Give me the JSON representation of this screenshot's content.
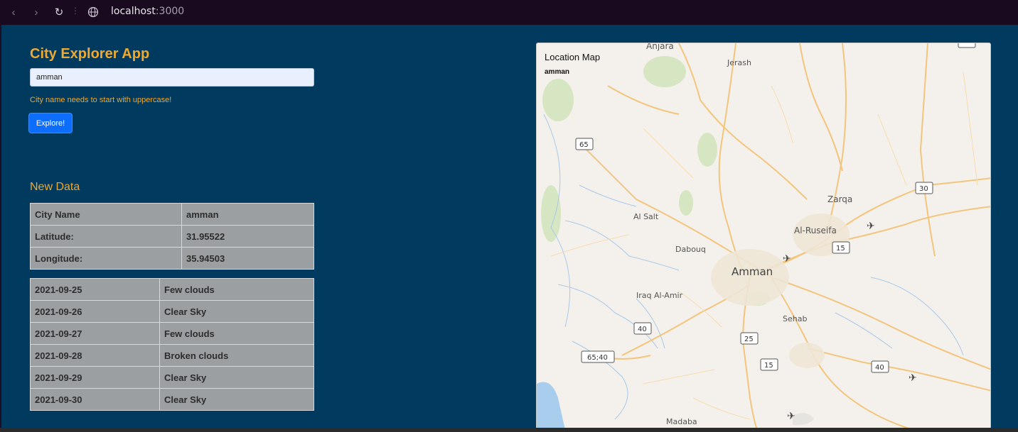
{
  "browser": {
    "url_host": "localhost",
    "url_port": ":3000"
  },
  "app": {
    "title": "City Explorer App",
    "search_value": "amman",
    "validation_message": "City name needs to start with uppercase!",
    "explore_label": "Explore!"
  },
  "new_data": {
    "title": "New Data",
    "rows": [
      {
        "label": "City Name",
        "value": "amman"
      },
      {
        "label": "Latitude:",
        "value": "31.95522"
      },
      {
        "label": "Longitude:",
        "value": "35.94503"
      }
    ]
  },
  "weather": {
    "rows": [
      {
        "date": "2021-09-25",
        "description": "Few clouds"
      },
      {
        "date": "2021-09-26",
        "description": "Clear Sky"
      },
      {
        "date": "2021-09-27",
        "description": "Few clouds"
      },
      {
        "date": "2021-09-28",
        "description": "Broken clouds"
      },
      {
        "date": "2021-09-29",
        "description": "Clear Sky"
      },
      {
        "date": "2021-09-30",
        "description": "Clear Sky"
      }
    ]
  },
  "map": {
    "title": "Location Map",
    "subtitle": "amman",
    "places": [
      "Anjara",
      "Jerash",
      "Al Salt",
      "Zarqa",
      "Al-Ruseifa",
      "Dabouq",
      "Amman",
      "Iraq Al-Amir",
      "Sehab",
      "Madaba"
    ],
    "road_shields": [
      "65",
      "30",
      "15",
      "40",
      "25",
      "65;40",
      "15",
      "40",
      "15"
    ]
  }
}
